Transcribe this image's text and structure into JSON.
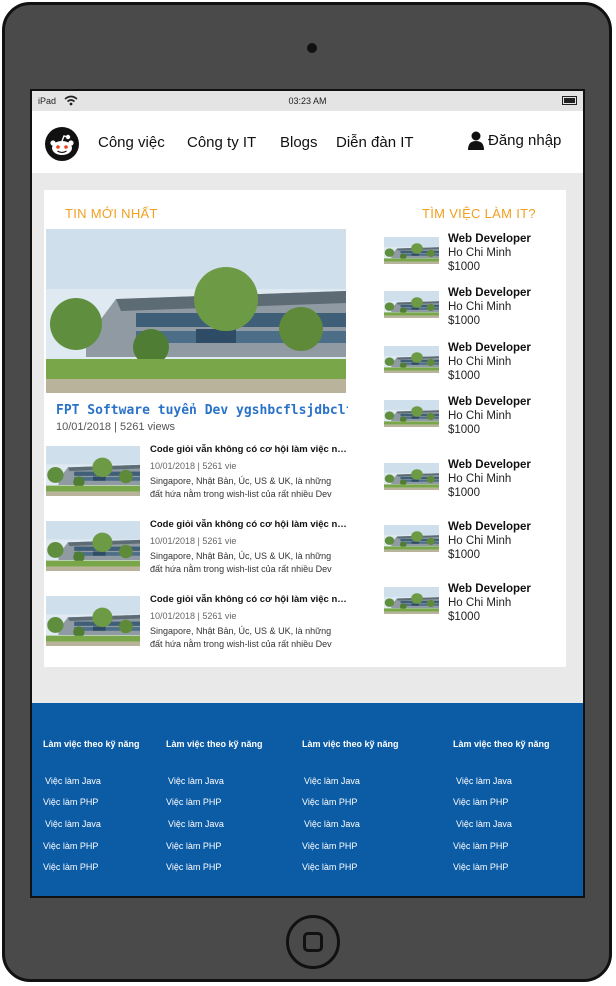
{
  "status_bar": {
    "device": "iPad",
    "time": "03:23 AM"
  },
  "nav": {
    "items": [
      "Công việc",
      "Công ty IT",
      "Blogs",
      "Diễn đàn IT"
    ],
    "login": "Đăng nhập"
  },
  "news": {
    "section_title": "TIN MỚI NHẤT",
    "hero": {
      "title": "FPT Software tuyển Dev ygshbcflsjdbclfsdjbc",
      "meta": "10/01/2018 | 5261 views"
    },
    "items": [
      {
        "title": "Code giỏi vẫn không có cơ hội làm việc nước ngoài",
        "meta": "10/01/2018 | 5261 vie",
        "desc1": "Singapore, Nhật Bản, Úc, US & UK, là những",
        "desc2": "đất hứa nằm trong wish-list của rất nhiều Dev"
      },
      {
        "title": "Code giỏi vẫn không có cơ hội làm việc nước ngoài",
        "meta": "10/01/2018 | 5261 vie",
        "desc1": "Singapore, Nhật Bản, Úc, US & UK, là những",
        "desc2": "đất hứa nằm trong wish-list của rất nhiều Dev"
      },
      {
        "title": "Code giỏi vẫn không có cơ hội làm việc nước ngoài",
        "meta": "10/01/2018 | 5261 vie",
        "desc1": "Singapore, Nhật Bản, Úc, US & UK, là những",
        "desc2": "đất hứa nằm trong wish-list của rất nhiều Dev"
      }
    ]
  },
  "jobs": {
    "section_title": "TÌM VIỆC LÀM IT?",
    "items": [
      {
        "title": "Web Developer",
        "location": "Ho Chi Minh",
        "salary": "$1000"
      },
      {
        "title": "Web Developer",
        "location": "Ho Chi Minh",
        "salary": "$1000"
      },
      {
        "title": "Web Developer",
        "location": "Ho Chi Minh",
        "salary": "$1000"
      },
      {
        "title": "Web Developer",
        "location": "Ho Chi Minh",
        "salary": "$1000"
      },
      {
        "title": "Web Developer",
        "location": "Ho Chi Minh",
        "salary": "$1000"
      },
      {
        "title": "Web Developer",
        "location": "Ho Chi Minh",
        "salary": "$1000"
      },
      {
        "title": "Web Developer",
        "location": "Ho Chi Minh",
        "salary": "$1000"
      }
    ]
  },
  "footer": {
    "columns": [
      {
        "heading": "Làm việc theo kỹ năng",
        "links": [
          "Việc làm Java",
          "Việc làm PHP",
          "Việc làm Java",
          "Việc làm PHP",
          "Việc làm PHP"
        ]
      },
      {
        "heading": "Làm việc theo kỹ năng",
        "links": [
          "Việc làm Java",
          "Việc làm PHP",
          "Việc làm Java",
          "Việc làm PHP",
          "Việc làm PHP"
        ]
      },
      {
        "heading": "Làm việc theo kỹ năng",
        "links": [
          "Việc làm Java",
          "Việc làm PHP",
          "Việc làm Java",
          "Việc làm PHP",
          "Việc làm PHP"
        ]
      },
      {
        "heading": "Làm việc theo kỹ năng",
        "links": [
          "Việc làm Java",
          "Việc làm PHP",
          "Việc làm Java",
          "Việc làm PHP",
          "Việc làm PHP"
        ]
      }
    ]
  },
  "colors": {
    "accent": "#f0a020",
    "link": "#2a72c8",
    "footer_bg": "#0b5ba5"
  }
}
